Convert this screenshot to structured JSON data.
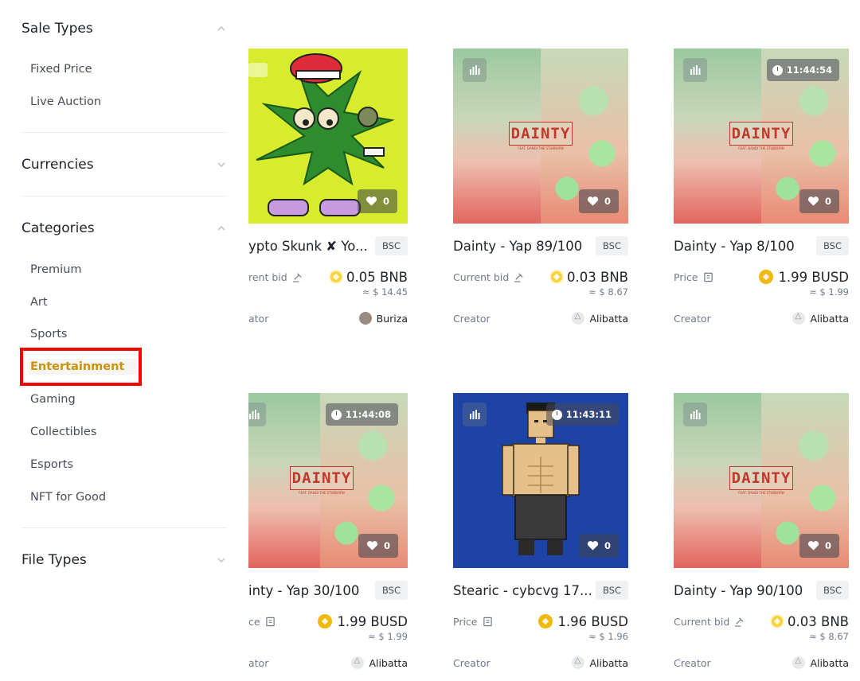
{
  "sidebar": {
    "sale_types": {
      "title": "Sale Types",
      "options": [
        "Fixed Price",
        "Live Auction"
      ]
    },
    "currencies": {
      "title": "Currencies"
    },
    "categories": {
      "title": "Categories",
      "options": [
        "Premium",
        "Art",
        "Sports",
        "Entertainment",
        "Gaming",
        "Collectibles",
        "Esports",
        "NFT for Good"
      ],
      "selected": "Entertainment"
    },
    "file_types": {
      "title": "File Types"
    }
  },
  "cards": [
    {
      "title": "ypto Skunk ✘ Yo...",
      "chain": "BSC",
      "price_label": "rent bid",
      "price": "0.05 BNB",
      "fiat": "≈ $ 14.45",
      "creator_label": "ator",
      "creator": "Buriza",
      "likes": "0",
      "timer": ""
    },
    {
      "title": "Dainty - Yap 89/100",
      "chain": "BSC",
      "price_label": "Current bid",
      "price": "0.03 BNB",
      "fiat": "≈ $ 8.67",
      "creator_label": "Creator",
      "creator": "Alibatta",
      "likes": "0",
      "timer": ""
    },
    {
      "title": "Dainty - Yap 8/100",
      "chain": "BSC",
      "price_label": "Price",
      "price": "1.99 BUSD",
      "fiat": "≈ $ 1.99",
      "creator_label": "Creator",
      "creator": "Alibatta",
      "likes": "0",
      "timer": "11:44:54"
    },
    {
      "title": "inty - Yap 30/100",
      "chain": "BSC",
      "price_label": "ce",
      "price": "1.99 BUSD",
      "fiat": "≈ $ 1.99",
      "creator_label": "ator",
      "creator": "Alibatta",
      "likes": "0",
      "timer": "11:44:08"
    },
    {
      "title": "Stearic - cybcvg 17...",
      "chain": "BSC",
      "price_label": "Price",
      "price": "1.96 BUSD",
      "fiat": "≈ $ 1.96",
      "creator_label": "Creator",
      "creator": "Alibatta",
      "likes": "0",
      "timer": "11:43:11"
    },
    {
      "title": "Dainty - Yap 90/100",
      "chain": "BSC",
      "price_label": "Current bid",
      "price": "0.03 BNB",
      "fiat": "≈ $ 8.67",
      "creator_label": "Creator",
      "creator": "Alibatta",
      "likes": "0",
      "timer": ""
    }
  ],
  "dainty_logo": "DAINTY",
  "dainty_sub": "FEAT. DANDI THE STUBBORN",
  "colors": {
    "accent": "#c99400",
    "highlight": "#ff0000",
    "bnb": "#f0b90b"
  }
}
